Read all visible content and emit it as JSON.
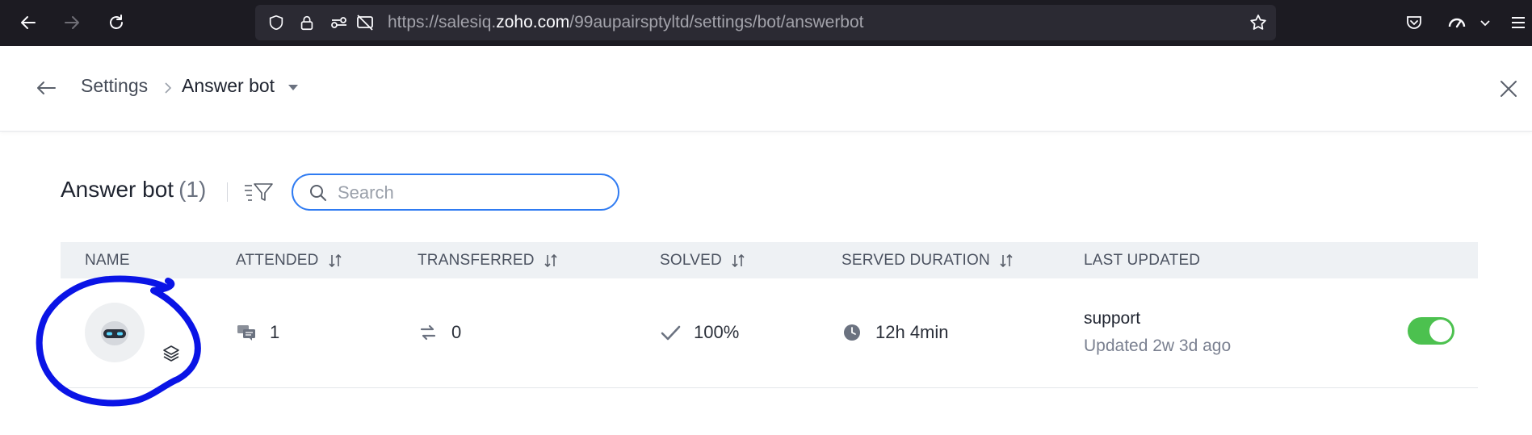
{
  "browser": {
    "url_prefix": "https://salesiq.",
    "url_domain": "zoho.com",
    "url_path": "/99aupairsptyltd/settings/bot/answerbot",
    "icons": [
      "back-icon",
      "forward-icon",
      "reload-icon",
      "shield-icon",
      "lock-icon",
      "permissions-icon",
      "blocked-media-icon",
      "bookmark-star-icon",
      "pocket-icon",
      "extension-icon",
      "menu-icon"
    ]
  },
  "header": {
    "breadcrumb": {
      "parent": "Settings",
      "current": "Answer bot"
    }
  },
  "toolbar": {
    "title": "Answer bot",
    "count": "(1)",
    "search_placeholder": "Search"
  },
  "table": {
    "columns": [
      {
        "label": "NAME",
        "sortable": false
      },
      {
        "label": "ATTENDED",
        "sortable": true
      },
      {
        "label": "TRANSFERRED",
        "sortable": true
      },
      {
        "label": "SOLVED",
        "sortable": true
      },
      {
        "label": "SERVED DURATION",
        "sortable": true
      },
      {
        "label": "LAST UPDATED",
        "sortable": false
      }
    ],
    "rows": [
      {
        "attended": "1",
        "transferred": "0",
        "solved": "100%",
        "served_duration": "12h 4min",
        "last_updated_by": "support",
        "last_updated_time": "Updated 2w 3d ago",
        "enabled": true
      }
    ]
  },
  "colors": {
    "accent": "#2f7bf2",
    "toggle_on": "#4cc14f",
    "annotation": "#0a14e6"
  }
}
